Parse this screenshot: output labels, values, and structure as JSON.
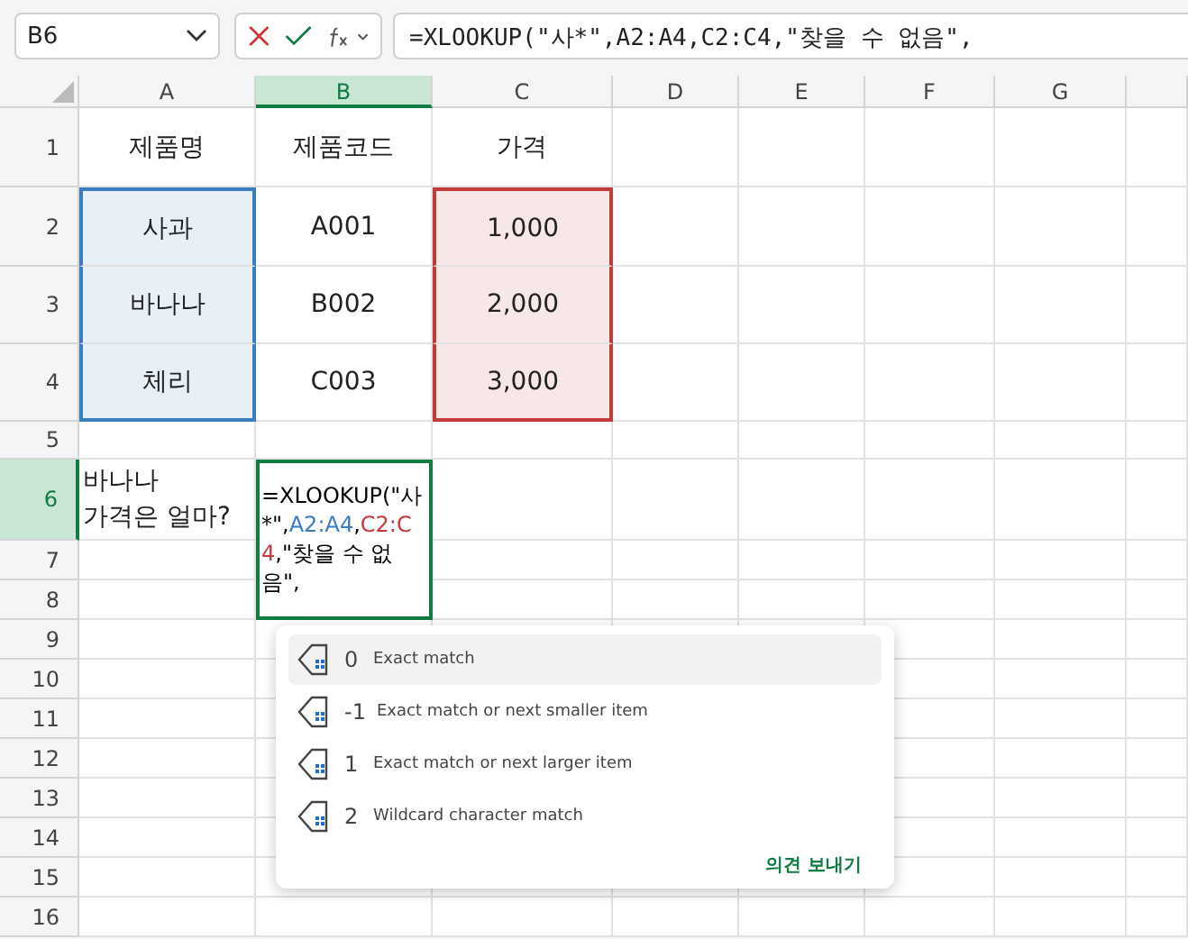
{
  "name_box": {
    "value": "B6"
  },
  "formula_bar": {
    "value": "=XLOOKUP(\"사*\",A2:A4,C2:C4,\"찾을 수 없음\","
  },
  "columns": [
    {
      "label": "A",
      "selected": false
    },
    {
      "label": "B",
      "selected": true
    },
    {
      "label": "C",
      "selected": false
    },
    {
      "label": "D",
      "selected": false
    },
    {
      "label": "E",
      "selected": false
    },
    {
      "label": "F",
      "selected": false
    },
    {
      "label": "G",
      "selected": false
    }
  ],
  "rows": [
    {
      "label": "1",
      "selected": false,
      "cells": [
        {
          "text": "제품명"
        },
        {
          "text": "제품코드"
        },
        {
          "text": "가격"
        }
      ]
    },
    {
      "label": "2",
      "selected": false,
      "cells": [
        {
          "text": "사과",
          "color": "#3a7ec0"
        },
        {
          "text": "A001"
        },
        {
          "text": "1,000",
          "color": "#c43b3b"
        }
      ]
    },
    {
      "label": "3",
      "selected": false,
      "cells": [
        {
          "text": "바나나",
          "color": "#3a7ec0"
        },
        {
          "text": "B002"
        },
        {
          "text": "2,000",
          "color": "#c43b3b"
        }
      ]
    },
    {
      "label": "4",
      "selected": false,
      "cells": [
        {
          "text": "체리",
          "color": "#3a7ec0"
        },
        {
          "text": "C003"
        },
        {
          "text": "3,000",
          "color": "#c43b3b"
        }
      ]
    },
    {
      "label": "5",
      "selected": false,
      "cells": []
    },
    {
      "label": "6",
      "selected": true,
      "cells": [
        {
          "text": "바나나\n가격은 얼마?"
        }
      ]
    },
    {
      "label": "7",
      "selected": false,
      "cells": []
    },
    {
      "label": "8",
      "selected": false,
      "cells": []
    },
    {
      "label": "9",
      "selected": false,
      "cells": []
    },
    {
      "label": "10",
      "selected": false,
      "cells": []
    },
    {
      "label": "11",
      "selected": false,
      "cells": []
    },
    {
      "label": "12",
      "selected": false,
      "cells": []
    },
    {
      "label": "13",
      "selected": false,
      "cells": []
    },
    {
      "label": "14",
      "selected": false,
      "cells": []
    },
    {
      "label": "15",
      "selected": false,
      "cells": []
    },
    {
      "label": "16",
      "selected": false,
      "cells": []
    }
  ],
  "editing_cell": {
    "tokens": [
      {
        "text": "=XLOOKUP(\"사*\","
      },
      {
        "text": "A2:A4",
        "color": "#3a7ec0"
      },
      {
        "text": ","
      },
      {
        "text": "C2:C4",
        "color": "#c43b3b"
      },
      {
        "text": ",\"찾을 수 없음\","
      }
    ]
  },
  "suggestions": {
    "items": [
      {
        "value": "0",
        "description": "Exact match",
        "selected": true
      },
      {
        "value": "-1",
        "description": "Exact match or next smaller item",
        "selected": false
      },
      {
        "value": "1",
        "description": "Exact match or next larger item",
        "selected": false
      },
      {
        "value": "2",
        "description": "Wildcard character match",
        "selected": false
      }
    ],
    "feedback_link": "의견 보내기"
  }
}
